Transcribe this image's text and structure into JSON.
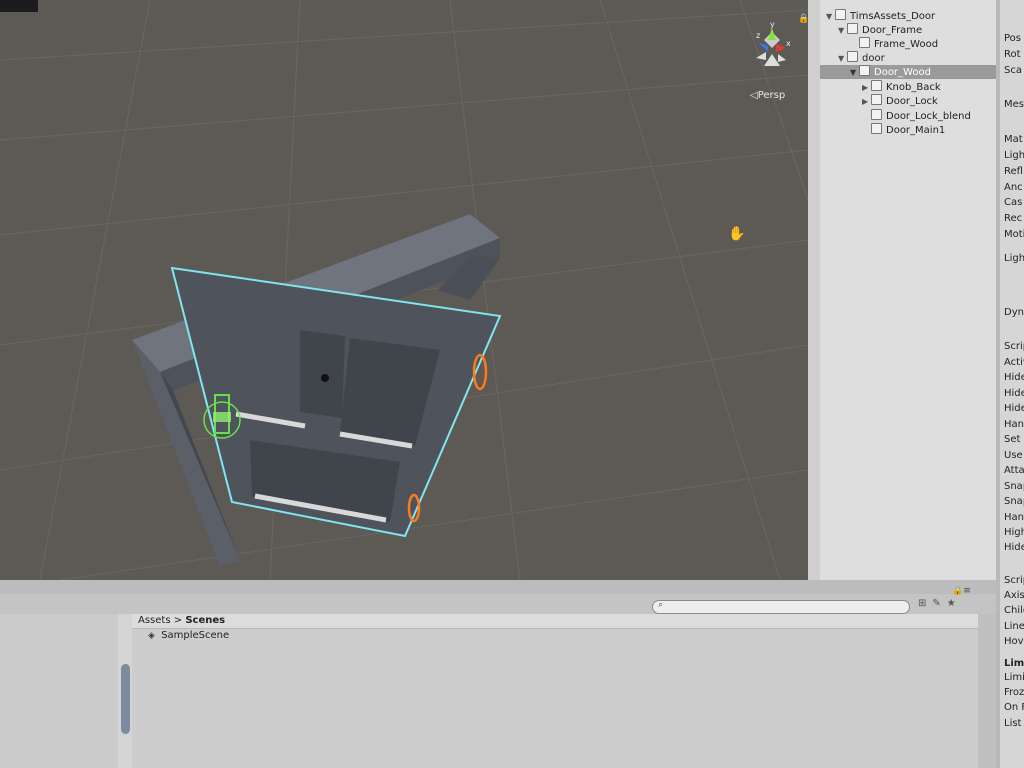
{
  "scene": {
    "projection_label": "◁Persp",
    "gizmo_axes": {
      "x": "x",
      "y": "y",
      "z": "z"
    },
    "colors": {
      "selection_outline": "#7fe6f0",
      "frame": "#5f6470",
      "door": "#4f535b",
      "collider": "#ff7a1a",
      "hand_gizmo": "#66e14c"
    }
  },
  "hierarchy": {
    "items": [
      {
        "label": "TimsAssets_Door",
        "depth": 0,
        "arrow": "▼"
      },
      {
        "label": "Door_Frame",
        "depth": 1,
        "arrow": "▼"
      },
      {
        "label": "Frame_Wood",
        "depth": 2,
        "arrow": ""
      },
      {
        "label": "door",
        "depth": 1,
        "arrow": "▼"
      },
      {
        "label": "Door_Wood",
        "depth": 2,
        "arrow": "▼",
        "selected": true
      },
      {
        "label": "Knob_Back",
        "depth": 3,
        "arrow": "▶"
      },
      {
        "label": "Door_Lock",
        "depth": 3,
        "arrow": "▶"
      },
      {
        "label": "Door_Lock_blend",
        "depth": 3,
        "arrow": ""
      },
      {
        "label": "Door_Main1",
        "depth": 3,
        "arrow": ""
      }
    ]
  },
  "inspector": {
    "rows": [
      "Pos",
      "Rot",
      "Sca",
      "Mes",
      "Mat",
      "Ligh",
      "Refl",
      "Anc",
      "Cas",
      "Rec",
      "Moti",
      "Ligh",
      "Dyna",
      "Scrip",
      "Activ",
      "Hide",
      "Hide",
      "Hide",
      "Hand",
      "Set R",
      "Use H",
      "Attac",
      "Snap",
      "Snap",
      "Hand",
      "Highl",
      "Hide H",
      "Scrip",
      "Axis O",
      "Child",
      "Linear",
      "Hover",
      "Limite",
      "Limited",
      "Frozen",
      "On Fro",
      "List is"
    ]
  },
  "project": {
    "breadcrumb_root": "Assets",
    "breadcrumb_sep": ">",
    "breadcrumb_current": "Scenes",
    "items": [
      {
        "label": "SampleScene",
        "icon": "unity-scene-icon"
      }
    ]
  }
}
